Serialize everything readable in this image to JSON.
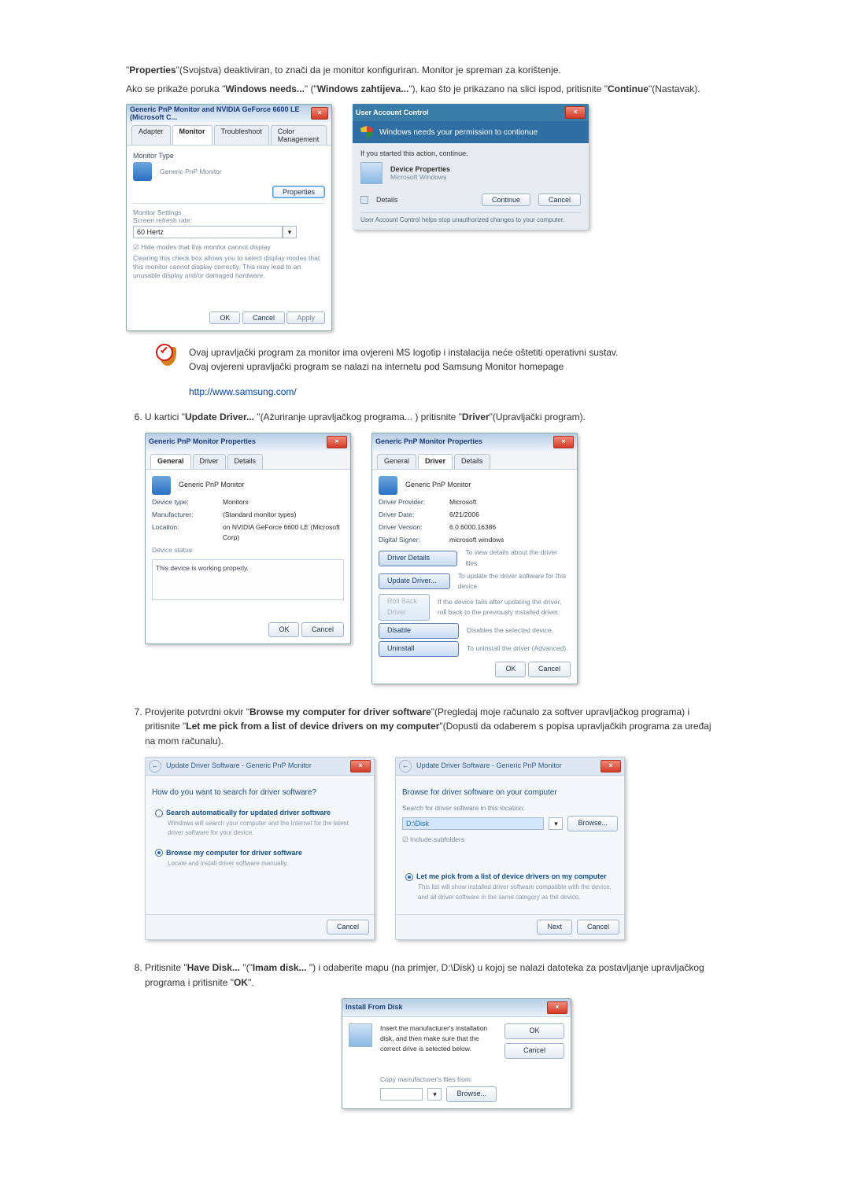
{
  "intro": {
    "p1_a": "\"",
    "p1_b": "Properties",
    "p1_c": "\"(Svojstva) deaktiviran, to znači da je monitor konfiguriran. Monitor je spreman za korištenje.",
    "p2_a": "Ako se prikaže poruka \"",
    "p2_b": "Windows needs...",
    "p2_c": "\" (\"",
    "p2_d": "Windows zahtijeva...",
    "p2_e": "\"), kao što je prikazano na slici ispod, pritisnite \"",
    "p2_f": "Continue",
    "p2_g": "\"(Nastavak)."
  },
  "note": {
    "line1": "Ovaj upravljački program za monitor ima ovjereni MS logotip i instalacija neće oštetiti operativni sustav.",
    "line2": "Ovaj ovjereni upravljački program se nalazi na internetu pod Samsung Monitor homepage",
    "link": "http://www.samsung.com/"
  },
  "step6": {
    "text_a": "U kartici \"",
    "text_b": "Update Driver...",
    "text_c": " \"(Ažuriranje upravljačkog programa... ) pritisnite \"",
    "text_d": "Driver",
    "text_e": "\"(Upravljački program)."
  },
  "step7": {
    "text_a": "Provjerite potvrdni okvir \"",
    "text_b": "Browse my computer for driver software",
    "text_c": "\"(Pregledaj moje računalo za softver upravljačkog programa) i pritisnite \"",
    "text_d": "Let me pick from a list of device drivers on my computer",
    "text_e": "\"(Dopusti da odaberem s popisa upravljačkih programa za uređaj na mom računalu)."
  },
  "step8": {
    "text_a": "Pritisnite \"",
    "text_b": "Have Disk...",
    "text_c": " \"(\"",
    "text_d": "Imam disk...",
    "text_e": " \") i odaberite mapu (na primjer, D:\\Disk) u kojoj se nalazi datoteka za postavljanje upravljačkog programa i pritisnite \"",
    "text_f": "OK",
    "text_g": "\"."
  },
  "fig1": {
    "title": "Generic PnP Monitor and NVIDIA GeForce 6600 LE (Microsoft C...",
    "tabs": [
      "Adapter",
      "Monitor",
      "Troubleshoot",
      "Color Management"
    ],
    "monitor_type": "Monitor Type",
    "monitor_name": "Generic PnP Monitor",
    "properties_btn": "Properties",
    "settings_hdr": "Monitor Settings",
    "refresh_lbl": "Screen refresh rate:",
    "refresh_val": "60 Hertz",
    "hide_modes": "Hide modes that this monitor cannot display",
    "hide_desc": "Clearing this check box allows you to select display modes that this monitor cannot display correctly. This may lead to an unusable display and/or damaged hardware.",
    "ok": "OK",
    "cancel": "Cancel",
    "apply": "Apply"
  },
  "uac": {
    "title": "User Account Control",
    "headline": "Windows needs your permission to contionue",
    "started": "If you started this action, continue.",
    "item_title": "Device Properties",
    "item_sub": "Microsoft Windows",
    "details": "Details",
    "continue": "Continue",
    "cancel": "Cancel",
    "footer": "User Account Control helps stop unauthorized changes to your computer."
  },
  "prop1": {
    "title": "Generic PnP Monitor Properties",
    "tabs": [
      "General",
      "Driver",
      "Details"
    ],
    "heading": "Generic PnP Monitor",
    "rows": {
      "devtype_lbl": "Device type:",
      "devtype_val": "Monitors",
      "manuf_lbl": "Manufacturer:",
      "manuf_val": "(Standard monitor types)",
      "loc_lbl": "Location:",
      "loc_val": "on NVIDIA GeForce 6600 LE (Microsoft Corp)"
    },
    "status_hdr": "Device status",
    "status_txt": "This device is working properly.",
    "ok": "OK",
    "cancel": "Cancel"
  },
  "prop2": {
    "title": "Generic PnP Monitor Properties",
    "tabs": [
      "General",
      "Driver",
      "Details"
    ],
    "heading": "Generic PnP Monitor",
    "rows": {
      "provider_lbl": "Driver Provider:",
      "provider_val": "Microsoft",
      "date_lbl": "Driver Date:",
      "date_val": "6/21/2006",
      "ver_lbl": "Driver Version:",
      "ver_val": "6.0.6000.16386",
      "signer_lbl": "Digital Signer:",
      "signer_val": "microsoft windows"
    },
    "btns": {
      "details": "Driver Details",
      "details_d": "To view details about the driver files.",
      "update": "Update Driver...",
      "update_d": "To update the driver software for this device.",
      "rollback": "Roll Back Driver",
      "rollback_d": "If the device fails after updating the driver, roll back to the previously installed driver.",
      "disable": "Disable",
      "disable_d": "Disables the selected device.",
      "uninstall": "Uninstall",
      "uninstall_d": "To uninstall the driver (Advanced)."
    },
    "ok": "OK",
    "cancel": "Cancel"
  },
  "wiz1": {
    "title": "Update Driver Software - Generic PnP Monitor",
    "heading": "How do you want to search for driver software?",
    "opt1": "Search automatically for updated driver software",
    "opt1_sub": "Windows will search your computer and the Internet for the latest driver software for your device.",
    "opt2": "Browse my computer for driver software",
    "opt2_sub": "Locate and install driver software manually.",
    "cancel": "Cancel"
  },
  "wiz2": {
    "title": "Update Driver Software - Generic PnP Monitor",
    "heading": "Browse for driver software on your computer",
    "search_lbl": "Search for driver software in this location:",
    "path": "D:\\Disk",
    "browse": "Browse...",
    "include": "Include subfolders",
    "letme": "Let me pick from a list of device drivers on my computer",
    "letme_sub": "This list will show installed driver software compatible with the device, and all driver software in the same category as the device.",
    "next": "Next",
    "cancel": "Cancel"
  },
  "ifd": {
    "title": "Install From Disk",
    "msg": "Insert the manufacturer's installation disk, and then make sure that the correct drive is selected below.",
    "ok": "OK",
    "cancel": "Cancel",
    "copy_lbl": "Copy manufacturer's files from:",
    "browse": "Browse..."
  }
}
